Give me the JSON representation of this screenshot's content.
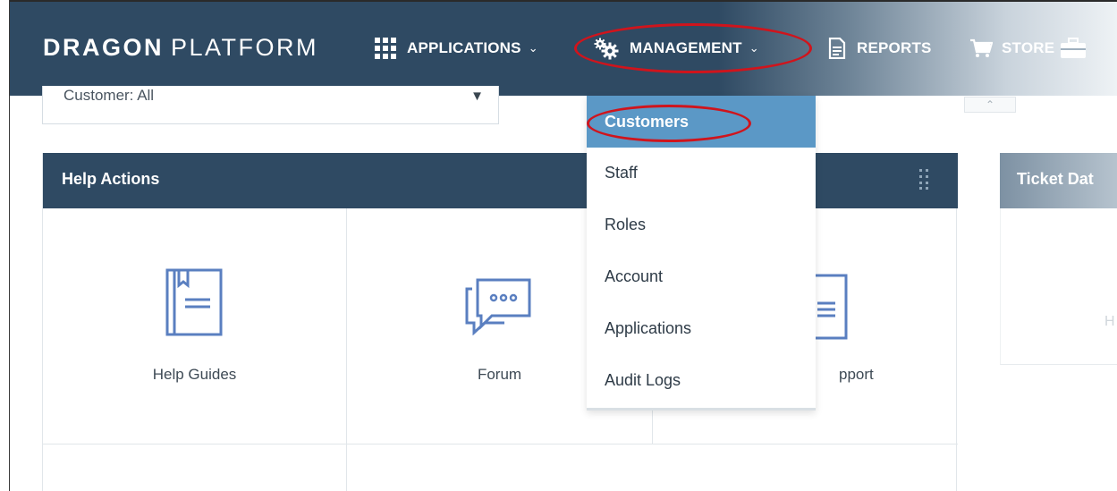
{
  "nav": {
    "brand_bold": "DRAGON",
    "brand_light": "PLATFORM",
    "items": [
      {
        "label": "APPLICATIONS",
        "icon": "grid-icon"
      },
      {
        "label": "MANAGEMENT",
        "icon": "gears-icon"
      },
      {
        "label": "REPORTS",
        "icon": "document-icon"
      },
      {
        "label": "STORE",
        "icon": "cart-icon"
      },
      {
        "label": "",
        "icon": "briefcase-icon"
      }
    ]
  },
  "customer_filter": {
    "value": "Customer: All"
  },
  "collapse": {
    "glyph": "⌃"
  },
  "management_menu": {
    "items": [
      "Customers",
      "Staff",
      "Roles",
      "Account",
      "Applications",
      "Audit Logs"
    ],
    "active": "Customers"
  },
  "help_actions": {
    "title": "Help Actions",
    "tiles": [
      {
        "label": "Help Guides",
        "icon": "book-icon"
      },
      {
        "label": "Forum",
        "icon": "chat-bubbles-icon"
      },
      {
        "label": "pport",
        "icon": "document-stack-icon"
      }
    ]
  },
  "ticket_panel": {
    "title": "Ticket Dat",
    "body_text": "H"
  },
  "colors": {
    "nav_bg": "#2f4a63",
    "panel_head": "#2f4a63",
    "active_item": "#5b98c6",
    "icon_blue": "#5a7fc0",
    "annotation_red": "#d0141c"
  }
}
